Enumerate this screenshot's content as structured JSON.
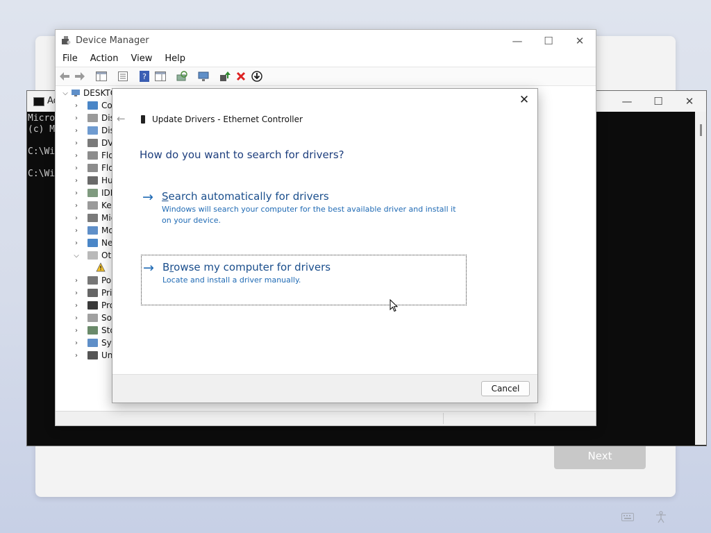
{
  "setup": {
    "next_label": "Next"
  },
  "cmd": {
    "title": "Ad",
    "lines": [
      "Micro",
      "(c) M",
      "",
      "C:\\Wi",
      "",
      "C:\\Wi"
    ]
  },
  "device_manager": {
    "title": "Device Manager",
    "menu": [
      "File",
      "Action",
      "View",
      "Help"
    ],
    "root_label": "DESKTO",
    "tree": [
      {
        "label": "Cor",
        "expanded": false
      },
      {
        "label": "Disk",
        "expanded": false
      },
      {
        "label": "Disp",
        "expanded": false
      },
      {
        "label": "DVD",
        "expanded": false
      },
      {
        "label": "Flop",
        "expanded": false
      },
      {
        "label": "Flop",
        "expanded": false
      },
      {
        "label": "Hun",
        "expanded": false
      },
      {
        "label": "IDE",
        "expanded": false
      },
      {
        "label": "Key",
        "expanded": false
      },
      {
        "label": "Mic",
        "expanded": false
      },
      {
        "label": "Mo",
        "expanded": false
      },
      {
        "label": "Net",
        "expanded": false
      },
      {
        "label": "Oth",
        "expanded": true
      },
      {
        "label": "",
        "child": true
      },
      {
        "label": "Por",
        "expanded": false
      },
      {
        "label": "Prin",
        "expanded": false
      },
      {
        "label": "Pro",
        "expanded": false
      },
      {
        "label": "Soft",
        "expanded": false
      },
      {
        "label": "Stor",
        "expanded": false
      },
      {
        "label": "Syst",
        "expanded": false
      },
      {
        "label": "Uni",
        "expanded": false
      }
    ]
  },
  "dialog": {
    "title": "Update Drivers - Ethernet Controller",
    "heading": "How do you want to search for drivers?",
    "option_auto": {
      "title": "Search automatically for drivers",
      "description": "Windows will search your computer for the best available driver and install it on your device."
    },
    "option_browse": {
      "title": "Browse my computer for drivers",
      "description": "Locate and install a driver manually."
    },
    "cancel_label": "Cancel"
  },
  "colors": {
    "heading": "#1d3e7d",
    "link": "#1f6ab4",
    "link_title": "#1a4e8c"
  }
}
